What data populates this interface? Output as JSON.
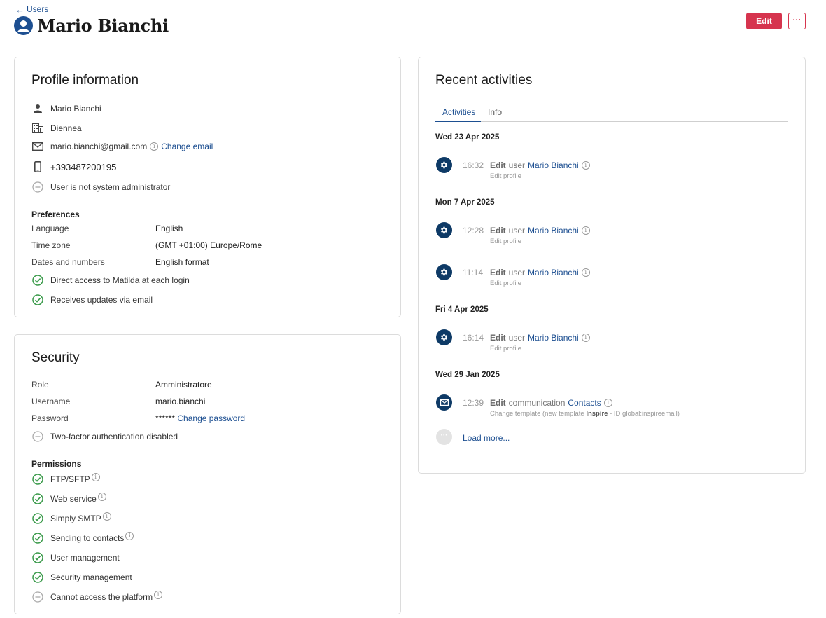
{
  "header": {
    "back_label": "Users",
    "title": "Mario Bianchi",
    "edit_label": "Edit",
    "more_label": "···"
  },
  "profile": {
    "title": "Profile information",
    "name": "Mario Bianchi",
    "company": "Diennea",
    "email": "mario.bianchi@gmail.com",
    "change_email": "Change email",
    "phone": "+393487200195",
    "admin_status": "User is not system administrator",
    "preferences_heading": "Preferences",
    "preferences": [
      {
        "key": "Language",
        "value": "English"
      },
      {
        "key": "Time zone",
        "value": "(GMT +01:00) Europe/Rome"
      },
      {
        "key": "Dates and numbers",
        "value": "English format"
      }
    ],
    "flags": [
      "Direct access to Matilda at each login",
      "Receives updates via email"
    ]
  },
  "security": {
    "title": "Security",
    "fields": [
      {
        "key": "Role",
        "value": "Amministratore"
      },
      {
        "key": "Username",
        "value": "mario.bianchi"
      },
      {
        "key": "Password",
        "value": "******"
      }
    ],
    "change_password": "Change password",
    "twofa": "Two-factor authentication disabled",
    "permissions_heading": "Permissions",
    "permissions": [
      {
        "label": "FTP/SFTP",
        "enabled": true,
        "info": true
      },
      {
        "label": "Web service",
        "enabled": true,
        "info": true
      },
      {
        "label": "Simply SMTP",
        "enabled": true,
        "info": true
      },
      {
        "label": "Sending to contacts",
        "enabled": true,
        "info": true
      },
      {
        "label": "User management",
        "enabled": true,
        "info": false
      },
      {
        "label": "Security management",
        "enabled": true,
        "info": false
      },
      {
        "label": "Cannot access the platform",
        "enabled": false,
        "info": true
      }
    ]
  },
  "activities": {
    "title": "Recent activities",
    "tabs": [
      "Activities",
      "Info"
    ],
    "groups": [
      {
        "date": "Wed 23 Apr 2025",
        "items": [
          {
            "icon": "gear-icon",
            "time": "16:32",
            "action": "Edit",
            "object": "user",
            "target": "Mario Bianchi",
            "detail": "Edit profile"
          }
        ]
      },
      {
        "date": "Mon 7 Apr 2025",
        "items": [
          {
            "icon": "gear-icon",
            "time": "12:28",
            "action": "Edit",
            "object": "user",
            "target": "Mario Bianchi",
            "detail": "Edit profile"
          },
          {
            "icon": "gear-icon",
            "time": "11:14",
            "action": "Edit",
            "object": "user",
            "target": "Mario Bianchi",
            "detail": "Edit profile"
          }
        ]
      },
      {
        "date": "Fri 4 Apr 2025",
        "items": [
          {
            "icon": "gear-icon",
            "time": "16:14",
            "action": "Edit",
            "object": "user",
            "target": "Mario Bianchi",
            "detail": "Edit profile"
          }
        ]
      },
      {
        "date": "Wed 29 Jan 2025",
        "items": [
          {
            "icon": "mail-icon",
            "time": "12:39",
            "action": "Edit",
            "object": "communication",
            "target": "Contacts",
            "detail_prefix": "Change template (new template ",
            "detail_bold": "Inspire",
            "detail_suffix": " - ID global:inspireemail)"
          }
        ]
      }
    ],
    "load_more": "Load more..."
  },
  "colors": {
    "accent": "#1d4f91",
    "danger": "#d6344e",
    "success": "#3a9a4a",
    "timeline_icon": "#0e3a66"
  }
}
